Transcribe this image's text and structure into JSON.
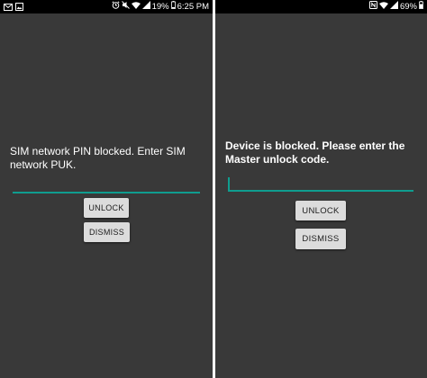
{
  "left_phone": {
    "status_bar": {
      "left_icons": [
        "envelope-icon",
        "image-icon"
      ],
      "right_icons": [
        "alarm-icon",
        "mute-icon",
        "wifi-icon",
        "signal-icon"
      ],
      "battery": "19%",
      "time": "6:25 PM"
    },
    "message": "SIM network PIN blocked. Enter SIM network PUK.",
    "pin_input": {
      "value": ""
    },
    "unlock_label": "UNLOCK",
    "dismiss_label": "DISMISS"
  },
  "right_phone": {
    "status_bar": {
      "right_icons": [
        "nfc-icon",
        "wifi-icon",
        "signal-icon"
      ],
      "battery": "69%"
    },
    "message": "Device is blocked. Please enter the Master unlock code.",
    "code_input": {
      "value": ""
    },
    "unlock_label": "UNLOCK",
    "dismiss_label": "DISMISS"
  },
  "colors": {
    "background": "#393939",
    "status_bar": "#000000",
    "accent": "#0f9d8f",
    "button": "#dcdcdc"
  }
}
